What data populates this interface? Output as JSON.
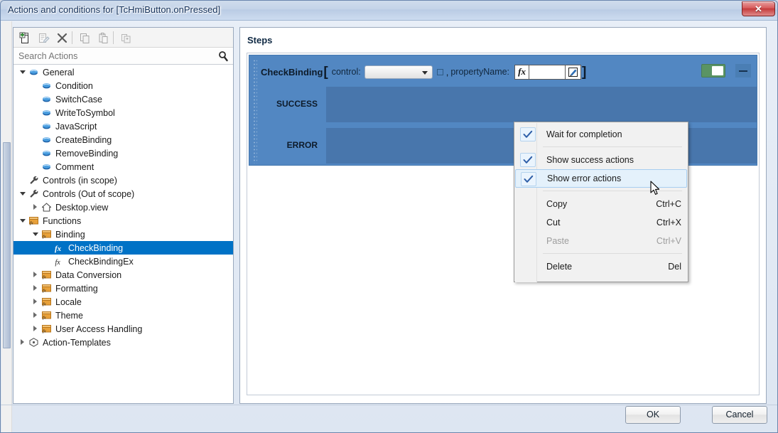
{
  "window": {
    "title": "Actions and conditions for [TcHmiButton.onPressed]",
    "close_label": "✕"
  },
  "toolbar": {
    "buttons": [
      {
        "name": "new-action-button",
        "tooltip": "New"
      },
      {
        "name": "edit-action-button",
        "tooltip": "Edit"
      },
      {
        "name": "delete-action-button",
        "tooltip": "Delete"
      },
      {
        "name": "copy-action-button",
        "tooltip": "Copy"
      },
      {
        "name": "paste-action-button",
        "tooltip": "Paste"
      },
      {
        "name": "duplicate-action-button",
        "tooltip": "Duplicate"
      }
    ]
  },
  "search": {
    "placeholder": "Search Actions",
    "value": "",
    "icon": "search-icon"
  },
  "tree": {
    "nodes": [
      {
        "label": "General",
        "depth": 0,
        "arrow": "down",
        "icon": "action-icon",
        "selected": false
      },
      {
        "label": "Condition",
        "depth": 1,
        "arrow": "none",
        "icon": "action-icon",
        "selected": false
      },
      {
        "label": "SwitchCase",
        "depth": 1,
        "arrow": "none",
        "icon": "action-icon",
        "selected": false
      },
      {
        "label": "WriteToSymbol",
        "depth": 1,
        "arrow": "none",
        "icon": "action-icon",
        "selected": false
      },
      {
        "label": "JavaScript",
        "depth": 1,
        "arrow": "none",
        "icon": "action-icon",
        "selected": false
      },
      {
        "label": "CreateBinding",
        "depth": 1,
        "arrow": "none",
        "icon": "action-icon",
        "selected": false
      },
      {
        "label": "RemoveBinding",
        "depth": 1,
        "arrow": "none",
        "icon": "action-icon",
        "selected": false
      },
      {
        "label": "Comment",
        "depth": 1,
        "arrow": "none",
        "icon": "action-icon",
        "selected": false
      },
      {
        "label": "Controls (in scope)",
        "depth": 0,
        "arrow": "none",
        "icon": "wrench-icon",
        "selected": false
      },
      {
        "label": "Controls (Out of scope)",
        "depth": 0,
        "arrow": "down",
        "icon": "wrench-icon",
        "selected": false
      },
      {
        "label": "Desktop.view",
        "depth": 1,
        "arrow": "right",
        "icon": "home-icon",
        "selected": false
      },
      {
        "label": "Functions",
        "depth": 0,
        "arrow": "down",
        "icon": "function-folder-icon",
        "selected": false
      },
      {
        "label": "Binding",
        "depth": 1,
        "arrow": "down",
        "icon": "function-folder-icon",
        "selected": false
      },
      {
        "label": "CheckBinding",
        "depth": 2,
        "arrow": "none",
        "icon": "fx-bold-icon",
        "selected": true
      },
      {
        "label": "CheckBindingEx",
        "depth": 2,
        "arrow": "none",
        "icon": "fx-icon",
        "selected": false
      },
      {
        "label": "Data Conversion",
        "depth": 1,
        "arrow": "right",
        "icon": "function-folder-icon",
        "selected": false
      },
      {
        "label": "Formatting",
        "depth": 1,
        "arrow": "right",
        "icon": "function-folder-icon",
        "selected": false
      },
      {
        "label": "Locale",
        "depth": 1,
        "arrow": "right",
        "icon": "function-folder-icon",
        "selected": false
      },
      {
        "label": "Theme",
        "depth": 1,
        "arrow": "right",
        "icon": "function-folder-icon",
        "selected": false
      },
      {
        "label": "User Access Handling",
        "depth": 1,
        "arrow": "right",
        "icon": "function-folder-icon",
        "selected": false
      },
      {
        "label": "Action-Templates",
        "depth": 0,
        "arrow": "right",
        "icon": "template-icon",
        "selected": false
      }
    ]
  },
  "steps": {
    "title": "Steps",
    "block": {
      "function_name": "CheckBinding",
      "bracket_open": "[",
      "bracket_close": "]",
      "control_label": "control:",
      "control_value": "",
      "comma": ",",
      "property_label": "propertyName:",
      "fx_badge": "fx",
      "property_value": "",
      "toggle_state": "on",
      "collapse_label": "−",
      "branches": [
        {
          "label": "SUCCESS"
        },
        {
          "label": "ERROR"
        }
      ]
    }
  },
  "context_menu": {
    "items": [
      {
        "label": "Wait for completion",
        "accel": "",
        "checked": true,
        "enabled": true,
        "highlighted": false,
        "sep_after": true
      },
      {
        "label": "Show success actions",
        "accel": "",
        "checked": true,
        "enabled": true,
        "highlighted": false,
        "sep_after": false
      },
      {
        "label": "Show error actions",
        "accel": "",
        "checked": true,
        "enabled": true,
        "highlighted": true,
        "sep_after": true
      },
      {
        "label": "Copy",
        "accel": "Ctrl+C",
        "checked": false,
        "enabled": true,
        "highlighted": false,
        "sep_after": false
      },
      {
        "label": "Cut",
        "accel": "Ctrl+X",
        "checked": false,
        "enabled": true,
        "highlighted": false,
        "sep_after": false
      },
      {
        "label": "Paste",
        "accel": "Ctrl+V",
        "checked": false,
        "enabled": false,
        "highlighted": false,
        "sep_after": true
      },
      {
        "label": "Delete",
        "accel": "Del",
        "checked": false,
        "enabled": true,
        "highlighted": false,
        "sep_after": false
      }
    ]
  },
  "footer": {
    "ok_label": "OK",
    "cancel_label": "Cancel"
  },
  "colors": {
    "selection_blue": "#0072c6",
    "block_outer": "#5287c2",
    "block_inner": "#4876ac",
    "toggle_on": "#5a9464",
    "menu_highlight": "#e4f1fb",
    "close_red": "#c33a3a"
  }
}
